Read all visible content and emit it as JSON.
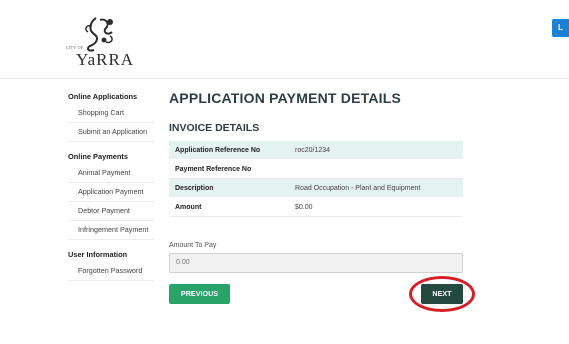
{
  "header": {
    "logo_city": "CITY OF",
    "logo_text": "YaRRA",
    "login_label": "L"
  },
  "sidebar": {
    "groups": [
      {
        "heading": "Online Applications",
        "items": [
          "Shopping Cart",
          "Submit an Application"
        ]
      },
      {
        "heading": "Online Payments",
        "items": [
          "Animal Payment",
          "Application Payment",
          "Debtor Payment",
          "Infringement Payment"
        ]
      },
      {
        "heading": "User Information",
        "items": [
          "Forgotten Password"
        ]
      }
    ]
  },
  "main": {
    "title": "APPLICATION PAYMENT DETAILS",
    "subtitle": "INVOICE DETAILS",
    "invoice": [
      {
        "label": "Application Reference No",
        "value": "roc20/1234"
      },
      {
        "label": "Payment Reference No",
        "value": ""
      },
      {
        "label": "Description",
        "value": "Road Occupation - Plant and Equipment"
      },
      {
        "label": "Amount",
        "value": "$0.00"
      }
    ],
    "amount_to_pay_label": "Amount To Pay",
    "amount_to_pay_value": "0.00",
    "previous_label": "PREVIOUS",
    "next_label": "NEXT"
  },
  "colors": {
    "accent_green": "#2aa36b",
    "dark_green": "#244a3f",
    "row_shade": "#e4f3ef",
    "highlight_red": "#d51e28",
    "login_blue": "#1a82d6"
  }
}
